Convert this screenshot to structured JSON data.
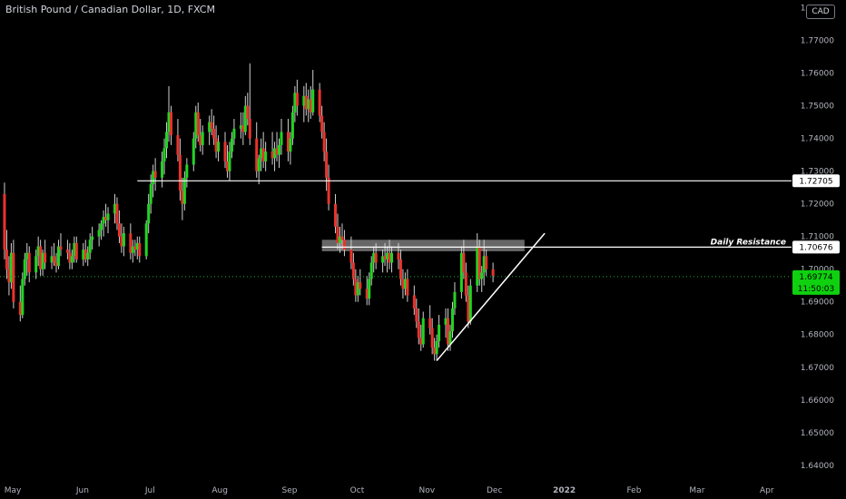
{
  "header": {
    "title": "British Pound / Canadian Dollar, 1D, FXCM",
    "currency": "CAD"
  },
  "colors": {
    "up": "#22d422",
    "down": "#e8332c",
    "wick": "#d0d0d0",
    "level_line": "#ffffff",
    "last_price_bg": "#0fd10f",
    "last_price_line": "#19b33a",
    "level_tag_bg": "#ffffff",
    "resistance_zone": "#8a8a8a"
  },
  "chart_data": {
    "type": "candlestick",
    "title": "British Pound / Canadian Dollar, 1D, FXCM",
    "xlabel": "",
    "ylabel": "",
    "x_ticks": [
      "May",
      "Jun",
      "Jul",
      "Aug",
      "Sep",
      "Oct",
      "Nov",
      "Dec",
      "2022",
      "Feb",
      "Mar",
      "Apr"
    ],
    "y_ticks": [
      "1.78000",
      "1.77000",
      "1.76000",
      "1.75000",
      "1.74000",
      "1.73000",
      "1.72000",
      "1.71000",
      "1.70000",
      "1.69000",
      "1.68000",
      "1.67000",
      "1.66000",
      "1.65000",
      "1.64000"
    ],
    "ylim": [
      1.638,
      1.781
    ],
    "grid": false,
    "x_start_date": "2021-05-01",
    "horizontal_levels": [
      {
        "price": 1.72705,
        "tag": "1.72705",
        "from_date": "2021-07-01"
      },
      {
        "price": 1.70676,
        "tag": "1.70676",
        "label": "Daily Resistance",
        "from_date": "2021-09-21"
      }
    ],
    "resistance_zone": {
      "from_date": "2021-09-21",
      "to_date": "2021-12-20",
      "price_low": 1.7055,
      "price_high": 1.709
    },
    "trendline": {
      "from": {
        "date": "2021-11-11",
        "price": 1.672
      },
      "to": {
        "date": "2021-12-29",
        "price": 1.711
      }
    },
    "last_price": {
      "value": "1.69774",
      "countdown": "11:50:03",
      "price": 1.69774
    },
    "candles": [
      [
        "2021-05-03",
        1.723,
        1.7265,
        1.703,
        1.706
      ],
      [
        "2021-05-04",
        1.706,
        1.712,
        1.697,
        1.7
      ],
      [
        "2021-05-05",
        1.7,
        1.704,
        1.692,
        1.696
      ],
      [
        "2021-05-06",
        1.696,
        1.708,
        1.694,
        1.705
      ],
      [
        "2021-05-07",
        1.705,
        1.709,
        1.688,
        1.69
      ],
      [
        "2021-05-10",
        1.69,
        1.695,
        1.684,
        1.686
      ],
      [
        "2021-05-11",
        1.686,
        1.699,
        1.685,
        1.697
      ],
      [
        "2021-05-12",
        1.697,
        1.705,
        1.695,
        1.703
      ],
      [
        "2021-05-13",
        1.703,
        1.708,
        1.698,
        1.705
      ],
      [
        "2021-05-14",
        1.705,
        1.707,
        1.696,
        1.699
      ],
      [
        "2021-05-17",
        1.699,
        1.706,
        1.697,
        1.704
      ],
      [
        "2021-05-18",
        1.704,
        1.71,
        1.701,
        1.707
      ],
      [
        "2021-05-19",
        1.707,
        1.709,
        1.698,
        1.7
      ],
      [
        "2021-05-20",
        1.7,
        1.706,
        1.698,
        1.705
      ],
      [
        "2021-05-21",
        1.705,
        1.709,
        1.7,
        1.702
      ],
      [
        "2021-05-24",
        1.702,
        1.707,
        1.7,
        1.704
      ],
      [
        "2021-05-25",
        1.704,
        1.708,
        1.701,
        1.702
      ],
      [
        "2021-05-26",
        1.702,
        1.705,
        1.699,
        1.701
      ],
      [
        "2021-05-27",
        1.701,
        1.709,
        1.7,
        1.707
      ],
      [
        "2021-05-28",
        1.707,
        1.711,
        1.704,
        1.706
      ],
      [
        "2021-05-31",
        1.706,
        1.709,
        1.703,
        1.705
      ],
      [
        "2021-06-01",
        1.705,
        1.708,
        1.7,
        1.702
      ],
      [
        "2021-06-02",
        1.702,
        1.706,
        1.7,
        1.704
      ],
      [
        "2021-06-03",
        1.704,
        1.71,
        1.702,
        1.708
      ],
      [
        "2021-06-04",
        1.708,
        1.71,
        1.702,
        1.703
      ],
      [
        "2021-06-07",
        1.703,
        1.708,
        1.701,
        1.706
      ],
      [
        "2021-06-08",
        1.706,
        1.709,
        1.702,
        1.703
      ],
      [
        "2021-06-09",
        1.703,
        1.707,
        1.701,
        1.705
      ],
      [
        "2021-06-10",
        1.705,
        1.711,
        1.703,
        1.709
      ],
      [
        "2021-06-11",
        1.709,
        1.713,
        1.706,
        1.71
      ],
      [
        "2021-06-14",
        1.71,
        1.714,
        1.707,
        1.712
      ],
      [
        "2021-06-15",
        1.712,
        1.715,
        1.709,
        1.714
      ],
      [
        "2021-06-16",
        1.714,
        1.718,
        1.71,
        1.716
      ],
      [
        "2021-06-17",
        1.716,
        1.72,
        1.713,
        1.715
      ],
      [
        "2021-06-18",
        1.715,
        1.719,
        1.711,
        1.717
      ],
      [
        "2021-06-21",
        1.717,
        1.723,
        1.714,
        1.72
      ],
      [
        "2021-06-22",
        1.72,
        1.722,
        1.712,
        1.714
      ],
      [
        "2021-06-23",
        1.714,
        1.718,
        1.708,
        1.71
      ],
      [
        "2021-06-24",
        1.71,
        1.714,
        1.705,
        1.707
      ],
      [
        "2021-06-25",
        1.707,
        1.713,
        1.704,
        1.711
      ],
      [
        "2021-06-28",
        1.711,
        1.714,
        1.703,
        1.705
      ],
      [
        "2021-06-29",
        1.705,
        1.709,
        1.702,
        1.707
      ],
      [
        "2021-06-30",
        1.707,
        1.709,
        1.704,
        1.706
      ],
      [
        "2021-07-01",
        1.706,
        1.71,
        1.703,
        1.708
      ],
      [
        "2021-07-02",
        1.708,
        1.71,
        1.702,
        1.704
      ],
      [
        "2021-07-05",
        1.704,
        1.715,
        1.703,
        1.714
      ],
      [
        "2021-07-06",
        1.714,
        1.723,
        1.711,
        1.72
      ],
      [
        "2021-07-07",
        1.72,
        1.729,
        1.717,
        1.726
      ],
      [
        "2021-07-08",
        1.726,
        1.732,
        1.722,
        1.73
      ],
      [
        "2021-07-09",
        1.73,
        1.734,
        1.724,
        1.728
      ],
      [
        "2021-07-12",
        1.728,
        1.736,
        1.725,
        1.733
      ],
      [
        "2021-07-13",
        1.733,
        1.74,
        1.729,
        1.737
      ],
      [
        "2021-07-14",
        1.737,
        1.745,
        1.734,
        1.742
      ],
      [
        "2021-07-15",
        1.742,
        1.756,
        1.739,
        1.748
      ],
      [
        "2021-07-16",
        1.748,
        1.75,
        1.738,
        1.741
      ],
      [
        "2021-07-19",
        1.741,
        1.746,
        1.733,
        1.735
      ],
      [
        "2021-07-20",
        1.735,
        1.74,
        1.721,
        1.724
      ],
      [
        "2021-07-21",
        1.724,
        1.728,
        1.715,
        1.72
      ],
      [
        "2021-07-22",
        1.72,
        1.73,
        1.718,
        1.728
      ],
      [
        "2021-07-23",
        1.728,
        1.734,
        1.725,
        1.732
      ],
      [
        "2021-07-26",
        1.732,
        1.742,
        1.73,
        1.74
      ],
      [
        "2021-07-27",
        1.74,
        1.75,
        1.737,
        1.748
      ],
      [
        "2021-07-28",
        1.748,
        1.751,
        1.739,
        1.741
      ],
      [
        "2021-07-29",
        1.741,
        1.746,
        1.736,
        1.738
      ],
      [
        "2021-07-30",
        1.738,
        1.744,
        1.735,
        1.742
      ],
      [
        "2021-08-02",
        1.742,
        1.747,
        1.738,
        1.745
      ],
      [
        "2021-08-03",
        1.745,
        1.749,
        1.741,
        1.743
      ],
      [
        "2021-08-04",
        1.743,
        1.747,
        1.738,
        1.74
      ],
      [
        "2021-08-05",
        1.74,
        1.744,
        1.734,
        1.736
      ],
      [
        "2021-08-06",
        1.736,
        1.741,
        1.733,
        1.739
      ],
      [
        "2021-08-09",
        1.739,
        1.742,
        1.731,
        1.733
      ],
      [
        "2021-08-10",
        1.733,
        1.738,
        1.728,
        1.73
      ],
      [
        "2021-08-11",
        1.73,
        1.739,
        1.727,
        1.736
      ],
      [
        "2021-08-12",
        1.736,
        1.742,
        1.734,
        1.74
      ],
      [
        "2021-08-13",
        1.74,
        1.746,
        1.738,
        1.743
      ],
      [
        "2021-08-16",
        1.743,
        1.748,
        1.74,
        1.744
      ],
      [
        "2021-08-17",
        1.744,
        1.748,
        1.738,
        1.742
      ],
      [
        "2021-08-18",
        1.742,
        1.753,
        1.741,
        1.75
      ],
      [
        "2021-08-19",
        1.75,
        1.754,
        1.744,
        1.746
      ],
      [
        "2021-08-20",
        1.746,
        1.763,
        1.738,
        1.74
      ],
      [
        "2021-08-23",
        1.74,
        1.745,
        1.728,
        1.73
      ],
      [
        "2021-08-24",
        1.73,
        1.735,
        1.726,
        1.734
      ],
      [
        "2021-08-25",
        1.734,
        1.74,
        1.73,
        1.737
      ],
      [
        "2021-08-26",
        1.737,
        1.742,
        1.731,
        1.733
      ],
      [
        "2021-08-27",
        1.733,
        1.739,
        1.73,
        1.736
      ],
      [
        "2021-08-30",
        1.736,
        1.742,
        1.732,
        1.734
      ],
      [
        "2021-08-31",
        1.734,
        1.739,
        1.73,
        1.737
      ],
      [
        "2021-09-01",
        1.737,
        1.742,
        1.733,
        1.735
      ],
      [
        "2021-09-02",
        1.735,
        1.74,
        1.731,
        1.738
      ],
      [
        "2021-09-03",
        1.738,
        1.746,
        1.735,
        1.742
      ],
      [
        "2021-09-06",
        1.742,
        1.746,
        1.733,
        1.736
      ],
      [
        "2021-09-07",
        1.736,
        1.742,
        1.732,
        1.74
      ],
      [
        "2021-09-08",
        1.74,
        1.75,
        1.738,
        1.748
      ],
      [
        "2021-09-09",
        1.748,
        1.756,
        1.745,
        1.754
      ],
      [
        "2021-09-10",
        1.754,
        1.758,
        1.747,
        1.75
      ],
      [
        "2021-09-13",
        1.75,
        1.756,
        1.745,
        1.753
      ],
      [
        "2021-09-14",
        1.753,
        1.757,
        1.747,
        1.749
      ],
      [
        "2021-09-15",
        1.749,
        1.755,
        1.745,
        1.752
      ],
      [
        "2021-09-16",
        1.752,
        1.756,
        1.746,
        1.748
      ],
      [
        "2021-09-17",
        1.748,
        1.761,
        1.747,
        1.755
      ],
      [
        "2021-09-20",
        1.755,
        1.757,
        1.745,
        1.747
      ],
      [
        "2021-09-21",
        1.747,
        1.75,
        1.74,
        1.742
      ],
      [
        "2021-09-22",
        1.742,
        1.745,
        1.733,
        1.736
      ],
      [
        "2021-09-23",
        1.736,
        1.74,
        1.724,
        1.728
      ],
      [
        "2021-09-24",
        1.728,
        1.732,
        1.718,
        1.72
      ],
      [
        "2021-09-27",
        1.72,
        1.723,
        1.711,
        1.713
      ],
      [
        "2021-09-28",
        1.713,
        1.717,
        1.706,
        1.708
      ],
      [
        "2021-09-29",
        1.708,
        1.713,
        1.705,
        1.71
      ],
      [
        "2021-09-30",
        1.71,
        1.714,
        1.706,
        1.709
      ],
      [
        "2021-10-01",
        1.709,
        1.712,
        1.704,
        1.706
      ],
      [
        "2021-10-04",
        1.706,
        1.71,
        1.7,
        1.702
      ],
      [
        "2021-10-05",
        1.702,
        1.705,
        1.695,
        1.697
      ],
      [
        "2021-10-06",
        1.697,
        1.7,
        1.69,
        1.692
      ],
      [
        "2021-10-07",
        1.692,
        1.698,
        1.69,
        1.696
      ],
      [
        "2021-10-08",
        1.696,
        1.7,
        1.692,
        1.694
      ],
      [
        "2021-10-11",
        1.694,
        1.698,
        1.689,
        1.691
      ],
      [
        "2021-10-12",
        1.691,
        1.699,
        1.689,
        1.697
      ],
      [
        "2021-10-13",
        1.697,
        1.704,
        1.695,
        1.702
      ],
      [
        "2021-10-14",
        1.702,
        1.707,
        1.699,
        1.705
      ],
      [
        "2021-10-15",
        1.705,
        1.708,
        1.7,
        1.702
      ],
      [
        "2021-10-18",
        1.702,
        1.706,
        1.699,
        1.704
      ],
      [
        "2021-10-19",
        1.704,
        1.708,
        1.701,
        1.703
      ],
      [
        "2021-10-20",
        1.703,
        1.707,
        1.699,
        1.705
      ],
      [
        "2021-10-21",
        1.705,
        1.709,
        1.7,
        1.702
      ],
      [
        "2021-10-22",
        1.702,
        1.707,
        1.699,
        1.705
      ],
      [
        "2021-10-25",
        1.705,
        1.708,
        1.7,
        1.703
      ],
      [
        "2021-10-26",
        1.703,
        1.706,
        1.695,
        1.697
      ],
      [
        "2021-10-27",
        1.697,
        1.7,
        1.691,
        1.694
      ],
      [
        "2021-10-28",
        1.694,
        1.699,
        1.692,
        1.697
      ],
      [
        "2021-10-29",
        1.697,
        1.7,
        1.69,
        1.692
      ],
      [
        "2021-11-01",
        1.692,
        1.695,
        1.686,
        1.688
      ],
      [
        "2021-11-02",
        1.688,
        1.691,
        1.682,
        1.684
      ],
      [
        "2021-11-03",
        1.684,
        1.688,
        1.677,
        1.679
      ],
      [
        "2021-11-04",
        1.679,
        1.683,
        1.675,
        1.677
      ],
      [
        "2021-11-05",
        1.677,
        1.687,
        1.676,
        1.685
      ],
      [
        "2021-11-08",
        1.685,
        1.689,
        1.68,
        1.682
      ],
      [
        "2021-11-09",
        1.682,
        1.685,
        1.674,
        1.676
      ],
      [
        "2021-11-10",
        1.676,
        1.679,
        1.672,
        1.674
      ],
      [
        "2021-11-11",
        1.674,
        1.68,
        1.672,
        1.678
      ],
      [
        "2021-11-12",
        1.678,
        1.686,
        1.676,
        1.683
      ],
      [
        "2021-11-15",
        1.683,
        1.688,
        1.679,
        1.685
      ],
      [
        "2021-11-16",
        1.685,
        1.688,
        1.675,
        1.677
      ],
      [
        "2021-11-17",
        1.677,
        1.683,
        1.675,
        1.681
      ],
      [
        "2021-11-18",
        1.681,
        1.69,
        1.679,
        1.688
      ],
      [
        "2021-11-19",
        1.688,
        1.696,
        1.686,
        1.693
      ],
      [
        "2021-11-22",
        1.693,
        1.707,
        1.691,
        1.705
      ],
      [
        "2021-11-23",
        1.705,
        1.709,
        1.697,
        1.699
      ],
      [
        "2021-11-24",
        1.699,
        1.702,
        1.69,
        1.692
      ],
      [
        "2021-11-25",
        1.692,
        1.695,
        1.682,
        1.684
      ],
      [
        "2021-11-26",
        1.684,
        1.697,
        1.683,
        1.695
      ],
      [
        "2021-11-29",
        1.695,
        1.711,
        1.693,
        1.707
      ],
      [
        "2021-11-30",
        1.707,
        1.709,
        1.695,
        1.697
      ],
      [
        "2021-12-01",
        1.697,
        1.701,
        1.693,
        1.699
      ],
      [
        "2021-12-02",
        1.699,
        1.709,
        1.695,
        1.704
      ],
      [
        "2021-12-03",
        1.704,
        1.706,
        1.698,
        1.7
      ],
      [
        "2021-12-06",
        1.7,
        1.702,
        1.696,
        1.698
      ]
    ]
  }
}
